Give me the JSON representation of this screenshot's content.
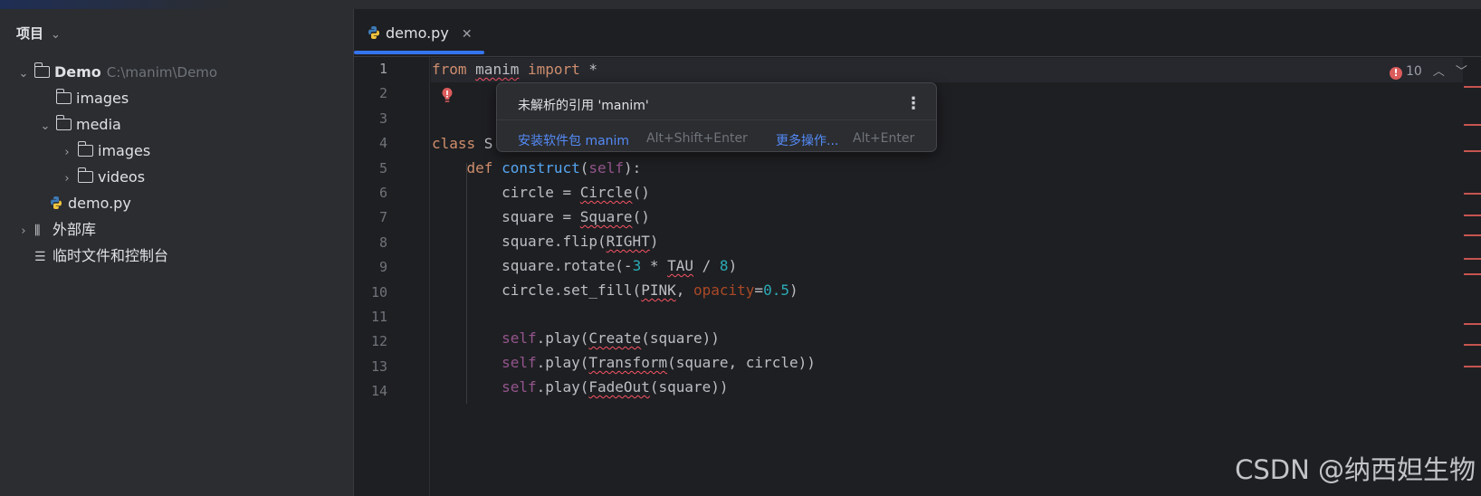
{
  "project_panel": {
    "title": "项目",
    "tree": [
      {
        "label": "Demo",
        "path_hint": "C:\\manim\\Demo"
      },
      {
        "label": "images"
      },
      {
        "label": "media"
      },
      {
        "label": "images"
      },
      {
        "label": "videos"
      },
      {
        "label": "demo.py"
      },
      {
        "label": "外部库"
      },
      {
        "label": "临时文件和控制台"
      }
    ]
  },
  "editor": {
    "tab": {
      "label": "demo.py"
    },
    "line_numbers": [
      "1",
      "2",
      "3",
      "4",
      "5",
      "6",
      "7",
      "8",
      "9",
      "10",
      "11",
      "12",
      "13",
      "14"
    ],
    "inspections": {
      "error_count": "10"
    }
  },
  "popup": {
    "message": "未解析的引用 'manim'",
    "action1": "安装软件包 manim",
    "action1_shortcut": "Alt+Shift+Enter",
    "action2": "更多操作...",
    "action2_shortcut": "Alt+Enter"
  },
  "watermark": "CSDN @纳西妲生物",
  "colors": {
    "accent": "#3574f0",
    "error": "#f75464",
    "keyword": "#cf8e6d",
    "function": "#56a8f5",
    "self": "#94558d",
    "number": "#2aacb8"
  }
}
